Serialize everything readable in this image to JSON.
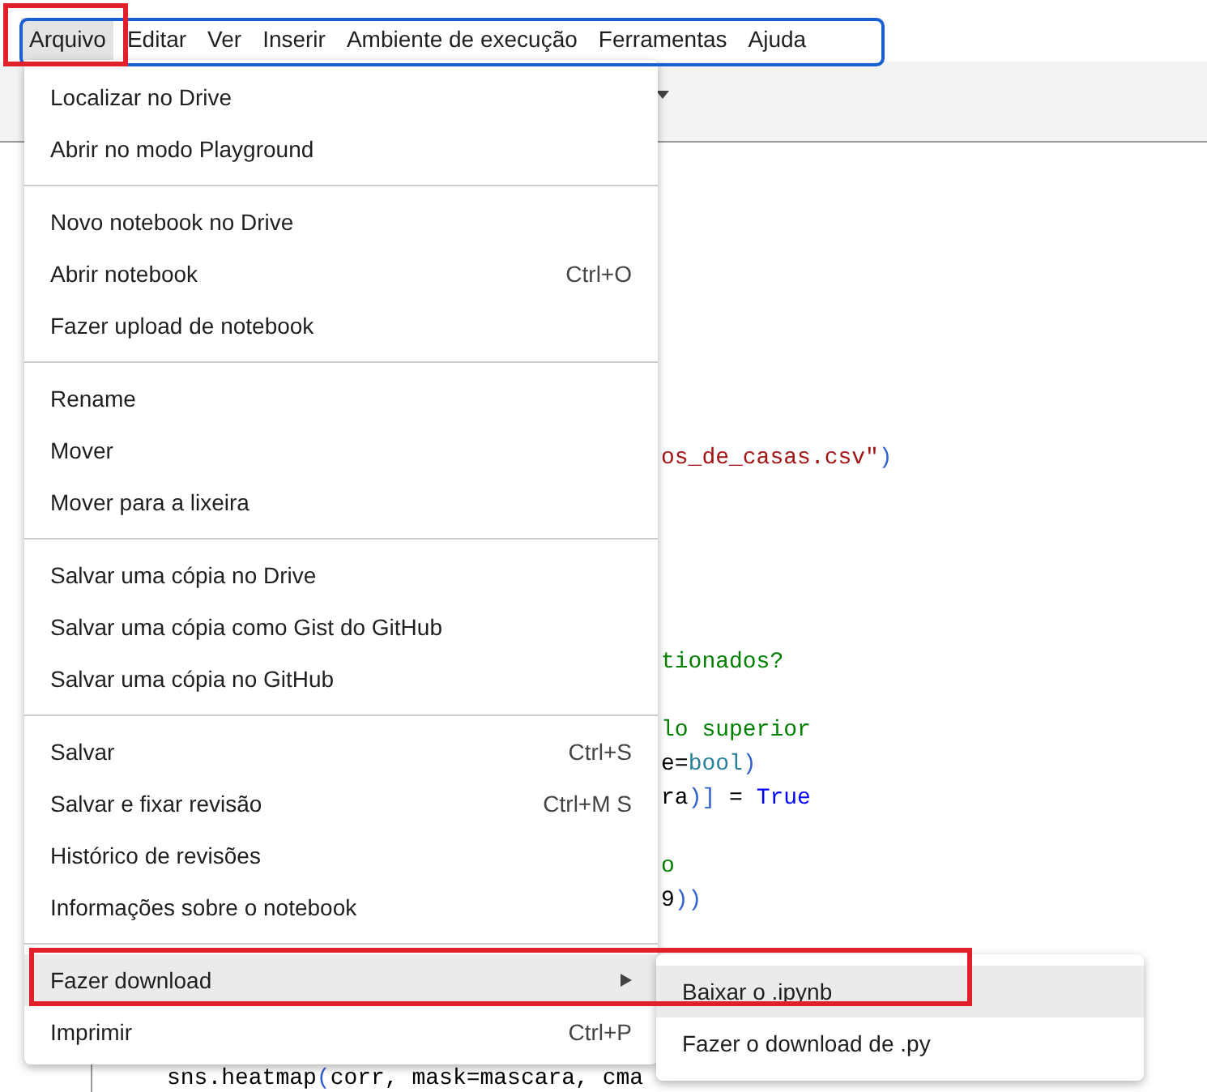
{
  "menubar": [
    {
      "label": "Arquivo",
      "selected": true
    },
    {
      "label": "Editar",
      "selected": false
    },
    {
      "label": "Ver",
      "selected": false
    },
    {
      "label": "Inserir",
      "selected": false
    },
    {
      "label": "Ambiente de execução",
      "selected": false
    },
    {
      "label": "Ferramentas",
      "selected": false
    },
    {
      "label": "Ajuda",
      "selected": false
    }
  ],
  "code_lines": [
    [
      {
        "kind": "string",
        "text": "os_de_casas.csv\""
      },
      {
        "kind": "bracket",
        "text": ")"
      }
    ],
    [
      {
        "kind": "comment",
        "text": "tionados?"
      }
    ],
    [
      {
        "kind": "comment",
        "text": "lo superior"
      }
    ],
    [
      {
        "kind": "plain",
        "text": "e="
      },
      {
        "kind": "builtin",
        "text": "bool"
      },
      {
        "kind": "bracket",
        "text": ")"
      }
    ],
    [
      {
        "kind": "plain",
        "text": "ra"
      },
      {
        "kind": "bracket",
        "text": ")]"
      },
      {
        "kind": "plain",
        "text": " = "
      },
      {
        "kind": "keyword",
        "text": "True"
      }
    ],
    [
      {
        "kind": "comment",
        "text": "o"
      }
    ],
    [
      {
        "kind": "plain",
        "text": "9"
      },
      {
        "kind": "bracket",
        "text": "))"
      }
    ],
    [
      {
        "kind": "plain",
        "text": "sns.heatmap"
      },
      {
        "kind": "bracket",
        "text": "("
      },
      {
        "kind": "plain",
        "text": "corr, mask=mascara, cma"
      }
    ]
  ],
  "file_menu": [
    [
      {
        "label": "Localizar no Drive",
        "kind": "item",
        "selected": false
      },
      {
        "label": "Abrir no modo Playground",
        "kind": "item",
        "selected": false
      }
    ],
    [
      {
        "label": "Novo notebook no Drive",
        "kind": "item",
        "selected": false
      },
      {
        "label": "Abrir notebook",
        "shortcut": "Ctrl+O",
        "kind": "item",
        "selected": false
      },
      {
        "label": "Fazer upload de notebook",
        "kind": "item",
        "selected": false
      }
    ],
    [
      {
        "label": "Rename",
        "kind": "item",
        "selected": false
      },
      {
        "label": "Mover",
        "kind": "item",
        "selected": false
      },
      {
        "label": "Mover para a lixeira",
        "kind": "item",
        "selected": false
      }
    ],
    [
      {
        "label": "Salvar uma cópia no Drive",
        "kind": "item",
        "selected": false
      },
      {
        "label": "Salvar uma cópia como Gist do GitHub",
        "kind": "item",
        "selected": false
      },
      {
        "label": "Salvar uma cópia no GitHub",
        "kind": "item",
        "selected": false
      }
    ],
    [
      {
        "label": "Salvar",
        "shortcut": "Ctrl+S",
        "kind": "item",
        "selected": false
      },
      {
        "label": "Salvar e fixar revisão",
        "shortcut": "Ctrl+M S",
        "kind": "item",
        "selected": false
      },
      {
        "label": "Histórico de revisões",
        "kind": "item",
        "selected": false
      },
      {
        "label": "Informações sobre o notebook",
        "kind": "item",
        "selected": false
      }
    ],
    [
      {
        "label": "Fazer download",
        "kind": "submenu",
        "selected": true
      },
      {
        "label": "Imprimir",
        "shortcut": "Ctrl+P",
        "kind": "item",
        "selected": false
      }
    ]
  ],
  "submenu": [
    {
      "label": "Baixar o .ipynb",
      "selected": true
    },
    {
      "label": "Fazer o download de .py",
      "selected": false
    }
  ]
}
